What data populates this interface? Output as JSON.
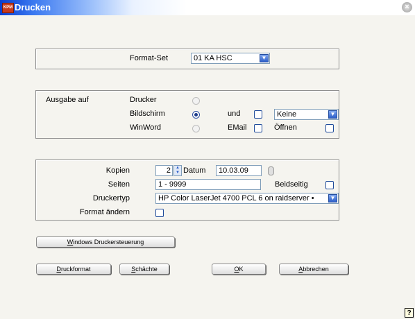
{
  "window": {
    "title": "Drucken",
    "app_icon": "printer-app-icon",
    "close_icon": "close-icon"
  },
  "format": {
    "label": "Format-Set",
    "value": "01 KA HSC"
  },
  "output": {
    "label": "Ausgabe auf",
    "drucker": "Drucker",
    "bildschirm": "Bildschirm",
    "winword": "WinWord",
    "selected": "Bildschirm",
    "und_label": "und",
    "email_label": "EMail",
    "keine_value": "Keine",
    "oeffnen_label": "Öffnen"
  },
  "print": {
    "kopien_label": "Kopien",
    "kopien_value": "2",
    "datum_label": "Datum",
    "datum_value": "10.03.09",
    "seiten_label": "Seiten",
    "seiten_value": "1 - 9999",
    "beidseitig_label": "Beidseitig",
    "druckertyp_label": "Druckertyp",
    "druckertyp_value": "HP Color LaserJet 4700 PCL 6 on raidserver •",
    "format_aendern_label": "Format ändern"
  },
  "buttons": {
    "windows_steuerung": {
      "hot": "W",
      "rest": "indows Druckersteuerung"
    },
    "druckformat": {
      "hot": "D",
      "rest": "ruckformat"
    },
    "schaechte": {
      "hot": "S",
      "rest": "chächte"
    },
    "ok": {
      "hot": "O",
      "rest": "K"
    },
    "abbrechen": {
      "hot": "A",
      "rest": "bbrechen"
    }
  },
  "help_label": "?"
}
